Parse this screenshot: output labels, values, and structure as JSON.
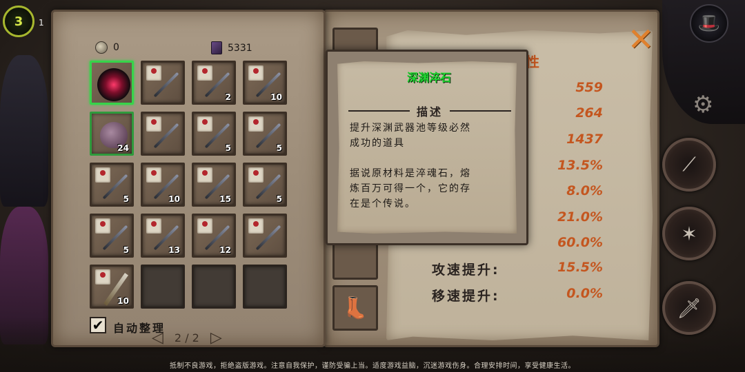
{
  "hud": {
    "level_badge": "3",
    "level_number": "1"
  },
  "currency": {
    "coins": "0",
    "books": "5331"
  },
  "inventory": {
    "cells": [
      {
        "type": "orb",
        "count": "",
        "selected": true
      },
      {
        "type": "weapon",
        "count": ""
      },
      {
        "type": "weapon",
        "count": "2"
      },
      {
        "type": "weapon",
        "count": "10"
      },
      {
        "type": "fruit",
        "count": "24",
        "green": true
      },
      {
        "type": "weapon",
        "count": ""
      },
      {
        "type": "weapon",
        "count": "5"
      },
      {
        "type": "weapon",
        "count": "5"
      },
      {
        "type": "weapon",
        "count": "5"
      },
      {
        "type": "weapon",
        "count": "10"
      },
      {
        "type": "weapon",
        "count": "15"
      },
      {
        "type": "weapon",
        "count": "5"
      },
      {
        "type": "weapon",
        "count": "5"
      },
      {
        "type": "weapon",
        "count": "13"
      },
      {
        "type": "weapon",
        "count": "12"
      },
      {
        "type": "weapon",
        "count": ""
      },
      {
        "type": "sword",
        "count": "10"
      },
      {
        "type": "empty",
        "count": ""
      },
      {
        "type": "empty",
        "count": ""
      },
      {
        "type": "empty",
        "count": ""
      }
    ],
    "auto_sort_label": "自动整理",
    "auto_sort_checked": "✔",
    "page": "2 / 2"
  },
  "tooltip": {
    "title": "深渊淬石",
    "section": "描述",
    "line1": "提升深渊武器池等级必然",
    "line2": "成功的道具",
    "line3": "据说原材料是淬魂石，熔",
    "line4": "炼百万可得一个，它的存",
    "line5": "在是个传说。"
  },
  "stats": {
    "title_fragment": "性",
    "values": [
      "559",
      "264",
      "1437",
      "13.5%",
      "8.0%",
      "21.0%",
      "60.0%"
    ],
    "attack_speed_label": "攻速提升:",
    "attack_speed_value": "15.5%",
    "move_speed_label": "移速提升:",
    "move_speed_value": "0.0%"
  },
  "close_glyph": "✕",
  "disclaimer": "抵制不良游戏，拒绝盗版游戏。注意自我保护，谨防受骗上当。适度游戏益脑，沉迷游戏伤身。合理安排时间，享受健康生活。",
  "colors": {
    "accent": "#c4561f",
    "title_green": "#1fd630",
    "selected_border": "#37d44a"
  }
}
